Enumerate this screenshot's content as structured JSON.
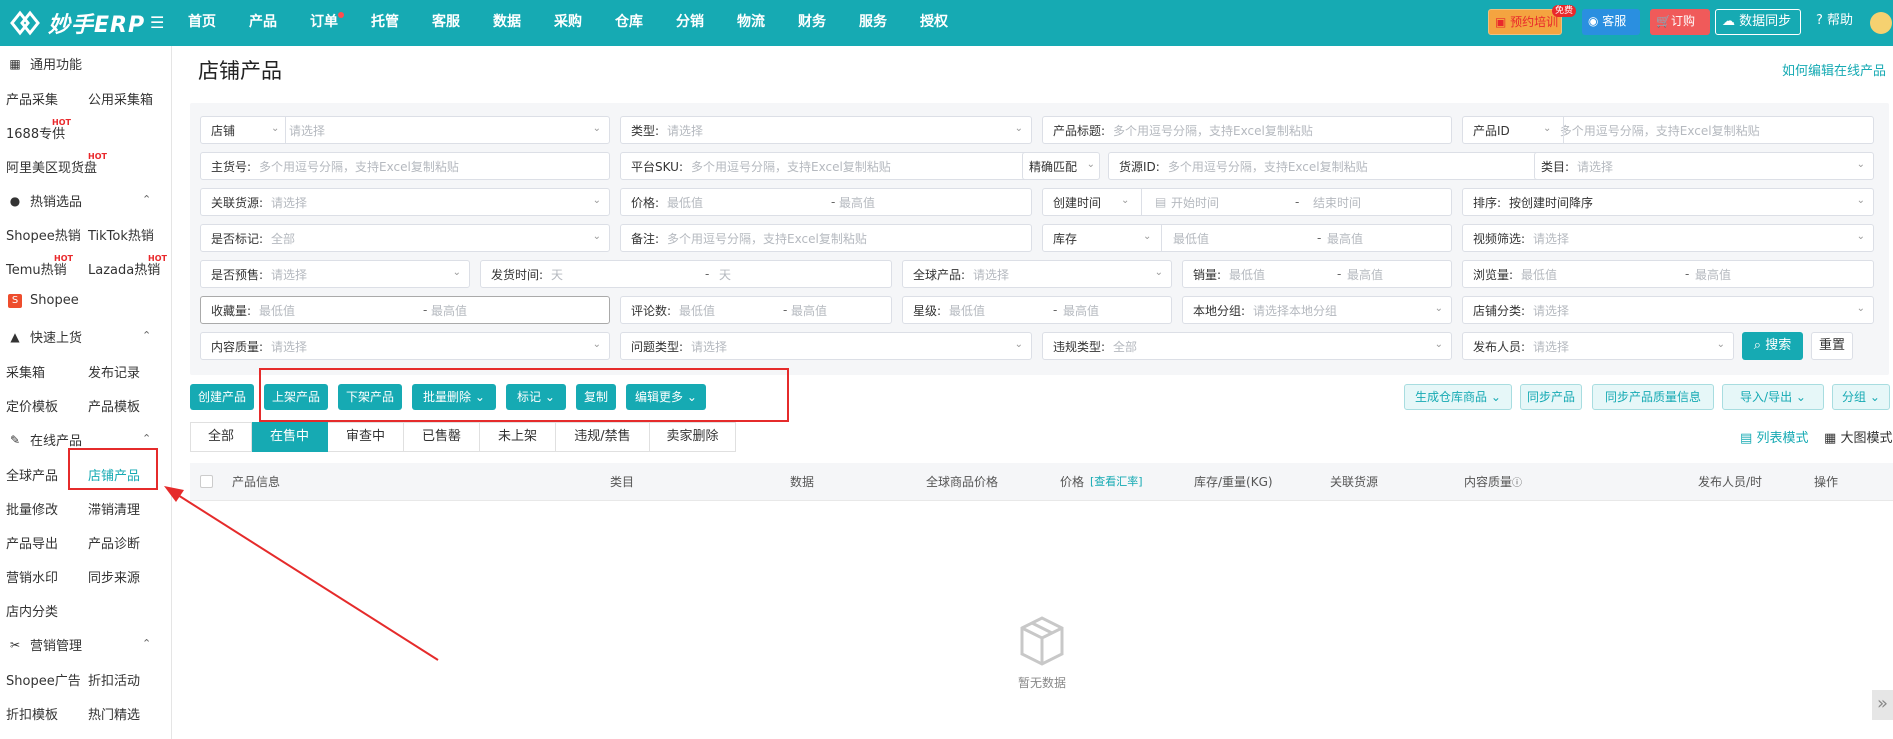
{
  "app": {
    "logo_text": "妙手ERP"
  },
  "nav": [
    "首页",
    "产品",
    "订单",
    "托管",
    "客服",
    "数据",
    "采购",
    "仓库",
    "分销",
    "物流",
    "财务",
    "服务",
    "授权"
  ],
  "topbar": {
    "training": "预约培训",
    "free_badge": "免费",
    "customer_service": "客服",
    "order": "订购",
    "data_sync": "数据同步",
    "help": "帮助"
  },
  "sidebar": {
    "common": "通用功能",
    "common_items": [
      "产品采集",
      "公用采集箱",
      "1688专供",
      "阿里美区现货盘"
    ],
    "hot_sell": "热销选品",
    "hot_items": [
      "Shopee热销",
      "TikTok热销",
      "Temu热销",
      "Lazada热销"
    ],
    "hot_badge": "HOT",
    "shopee": "Shopee",
    "quick": "快速上货",
    "quick_items": [
      "采集箱",
      "发布记录",
      "定价模板",
      "产品模板"
    ],
    "online": "在线产品",
    "online_items": [
      "全球产品",
      "店铺产品",
      "批量修改",
      "滞销清理",
      "产品导出",
      "产品诊断",
      "营销水印",
      "同步来源",
      "店内分类"
    ],
    "marketing": "营销管理",
    "marketing_items": [
      "Shopee广告",
      "折扣活动",
      "折扣模板",
      "热门精选"
    ]
  },
  "page": {
    "title": "店铺产品",
    "help_link": "如何编辑在线产品"
  },
  "filters": {
    "shop": {
      "label": "店铺",
      "placeholder": "请选择"
    },
    "category_type": {
      "label": "类型:",
      "placeholder": "请选择"
    },
    "title": {
      "label": "产品标题:",
      "placeholder": "多个用逗号分隔，支持Excel复制粘贴"
    },
    "product_id": {
      "label": "产品ID",
      "placeholder": "多个用逗号分隔，支持Excel复制粘贴"
    },
    "main_sku": {
      "label": "主货号:",
      "placeholder": "多个用逗号分隔，支持Excel复制粘贴"
    },
    "platform_sku": {
      "label": "平台SKU:",
      "placeholder": "多个用逗号分隔，支持Excel复制粘贴",
      "match": "精确匹配"
    },
    "source_id": {
      "label": "货源ID:",
      "placeholder": "多个用逗号分隔，支持Excel复制粘贴"
    },
    "category": {
      "label": "类目:",
      "placeholder": "请选择"
    },
    "linked_source": {
      "label": "关联货源:",
      "placeholder": "请选择"
    },
    "price": {
      "label": "价格:",
      "min": "最低值",
      "max": "最高值",
      "dash": "-"
    },
    "created": {
      "label": "创建时间",
      "start": "开始时间",
      "end": "结束时间"
    },
    "sort": {
      "label": "排序:",
      "value": "按创建时间降序"
    },
    "marked": {
      "label": "是否标记:",
      "value": "全部"
    },
    "remark": {
      "label": "备注:",
      "placeholder": "多个用逗号分隔，支持Excel复制粘贴"
    },
    "stock": {
      "label": "库存",
      "min": "最低值",
      "max": "最高值"
    },
    "video": {
      "label": "视频筛选:",
      "placeholder": "请选择"
    },
    "preorder": {
      "label": "是否预售:",
      "placeholder": "请选择"
    },
    "ship_time": {
      "label": "发货时间:",
      "min": "天",
      "max": "天"
    },
    "global_product": {
      "label": "全球产品:",
      "placeholder": "请选择"
    },
    "sales": {
      "label": "销量:",
      "min": "最低值",
      "max": "最高值"
    },
    "views": {
      "label": "浏览量:",
      "min": "最低值",
      "max": "最高值"
    },
    "favorites": {
      "label": "收藏量:",
      "min": "最低值",
      "max": "最高值"
    },
    "reviews": {
      "label": "评论数:",
      "min": "最低值",
      "max": "最高值"
    },
    "rating": {
      "label": "星级:",
      "min": "最低值",
      "max": "最高值"
    },
    "local_group": {
      "label": "本地分组:",
      "placeholder": "请选择本地分组"
    },
    "shop_category": {
      "label": "店铺分类:",
      "placeholder": "请选择"
    },
    "content_quality": {
      "label": "内容质量:",
      "placeholder": "请选择"
    },
    "issue_type": {
      "label": "问题类型:",
      "placeholder": "请选择"
    },
    "violation_type": {
      "label": "违规类型:",
      "value": "全部"
    },
    "publisher": {
      "label": "发布人员:",
      "placeholder": "请选择"
    },
    "search": "搜索",
    "reset": "重置"
  },
  "actions": {
    "create": "创建产品",
    "list": "上架产品",
    "delist": "下架产品",
    "batch_delete": "批量删除",
    "mark": "标记",
    "copy": "复制",
    "edit_more": "编辑更多",
    "gen_warehouse": "生成仓库商品",
    "sync_product": "同步产品",
    "sync_quality": "同步产品质量信息",
    "import_export": "导入/导出",
    "group": "分组"
  },
  "tabs": [
    "全部",
    "在售中",
    "审查中",
    "已售罄",
    "未上架",
    "违规/禁售",
    "卖家删除"
  ],
  "active_tab": "在售中",
  "view": {
    "list": "列表模式",
    "grid": "大图模式"
  },
  "table": {
    "columns": [
      "产品信息",
      "类目",
      "数据",
      "全球商品价格",
      "价格",
      "查看汇率",
      "库存/重量(KG)",
      "关联货源",
      "内容质量",
      "发布人员/时",
      "操作"
    ],
    "empty": "暂无数据"
  },
  "colors": {
    "primary": "#16aab3",
    "highlight": "#e52b2b"
  }
}
